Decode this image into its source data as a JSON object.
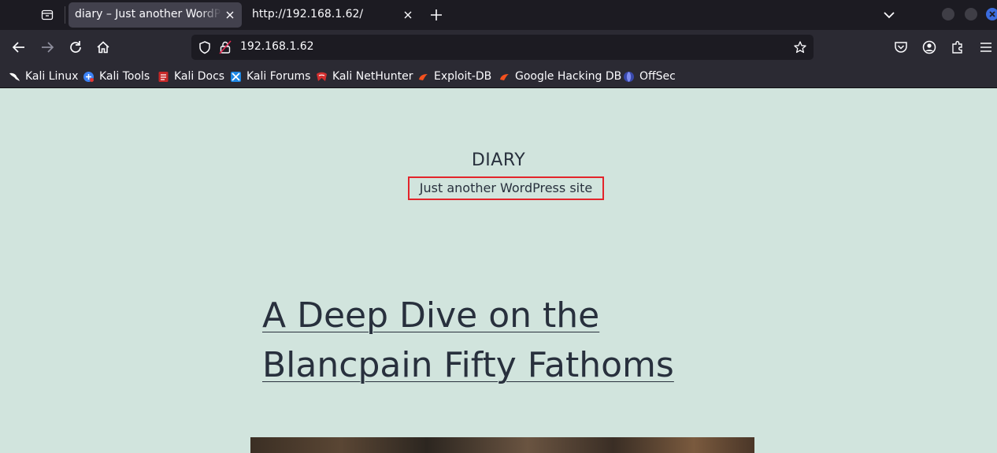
{
  "browser": {
    "tabs": [
      {
        "title": "diary – Just another WordPress site",
        "active": true
      },
      {
        "title": "http://192.168.1.62/",
        "active": false
      }
    ],
    "url": "192.168.1.62",
    "bookmarks": [
      {
        "label": "Kali Linux",
        "icon": "kali-dragon-icon"
      },
      {
        "label": "Kali Tools",
        "icon": "kali-tools-icon"
      },
      {
        "label": "Kali Docs",
        "icon": "kali-docs-icon"
      },
      {
        "label": "Kali Forums",
        "icon": "kali-forums-icon"
      },
      {
        "label": "Kali NetHunter",
        "icon": "kali-nethunter-icon"
      },
      {
        "label": "Exploit-DB",
        "icon": "exploit-db-icon"
      },
      {
        "label": "Google Hacking DB",
        "icon": "ghdb-icon"
      },
      {
        "label": "OffSec",
        "icon": "offsec-icon"
      }
    ]
  },
  "site": {
    "title": "DIARY",
    "description": "Just another WordPress site"
  },
  "post": {
    "title": "A Deep Dive on the Blancpain Fifty Fathoms"
  },
  "colors": {
    "page_background": "#d1e4dd",
    "text": "#28303d",
    "highlight_box": "#e3242b"
  }
}
